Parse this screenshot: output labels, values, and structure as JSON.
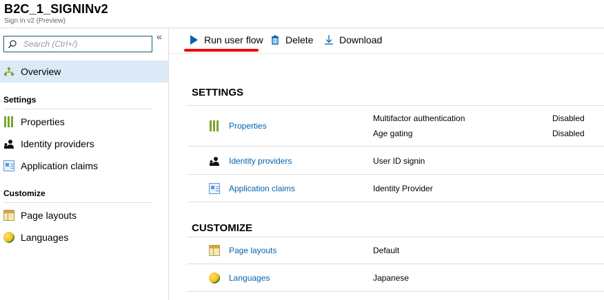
{
  "header": {
    "title": "B2C_1_SIGNINv2",
    "subtitle": "Sign in v2 (Preview)"
  },
  "sidebar": {
    "search_placeholder": "Search (Ctrl+/)",
    "collapse_glyph": "«",
    "overview": "Overview",
    "sections": [
      {
        "title": "Settings",
        "items": [
          {
            "label": "Properties",
            "icon": "properties-icon"
          },
          {
            "label": "Identity providers",
            "icon": "identity-providers-icon"
          },
          {
            "label": "Application claims",
            "icon": "application-claims-icon"
          }
        ]
      },
      {
        "title": "Customize",
        "items": [
          {
            "label": "Page layouts",
            "icon": "page-layouts-icon"
          },
          {
            "label": "Languages",
            "icon": "languages-icon"
          }
        ]
      }
    ]
  },
  "toolbar": {
    "run": "Run user flow",
    "delete": "Delete",
    "download": "Download"
  },
  "main": {
    "settings_title": "SETTINGS",
    "customize_title": "CUSTOMIZE",
    "properties": {
      "link": "Properties",
      "rows": [
        {
          "name": "Multifactor authentication",
          "status": "Disabled"
        },
        {
          "name": "Age gating",
          "status": "Disabled"
        }
      ]
    },
    "identity_providers": {
      "link": "Identity providers",
      "value": "User ID signin"
    },
    "application_claims": {
      "link": "Application claims",
      "value": "Identity Provider"
    },
    "page_layouts": {
      "link": "Page layouts",
      "value": "Default"
    },
    "languages": {
      "link": "Languages",
      "value": "Japanese"
    }
  },
  "colors": {
    "accent": "#0063b1",
    "active_nav_bg": "#dceaf7",
    "highlight_underline": "#e00000"
  }
}
